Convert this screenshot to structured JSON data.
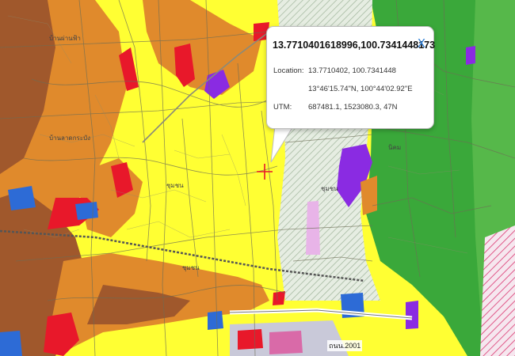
{
  "popup": {
    "title": "13.7710401618996,100.7341448173",
    "close_label": "X",
    "location_label": "Location:",
    "location_decimal": "13.7710402, 100.7341448",
    "location_dms": "13°46'15.74\"N, 100°44'02.92\"E",
    "utm_label": "UTM:",
    "utm_value": "687481.1, 1523080.3, 47N"
  },
  "map": {
    "road_label": "ถนน.2001",
    "icons": {
      "close": "close-icon",
      "marker": "crosshair-marker-icon"
    },
    "colors": {
      "residential_low": "#ffff33",
      "residential_medium": "#e08a2c",
      "residential_high": "#a0582c",
      "commercial": "#e8182a",
      "agricultural": "#3aa83a",
      "rural_conservation": "#d9e8d0",
      "government": "#2d6bd6",
      "industrial": "#8a2be2",
      "marker": "#e8182a",
      "popup_close": "#2f7fd6"
    }
  }
}
